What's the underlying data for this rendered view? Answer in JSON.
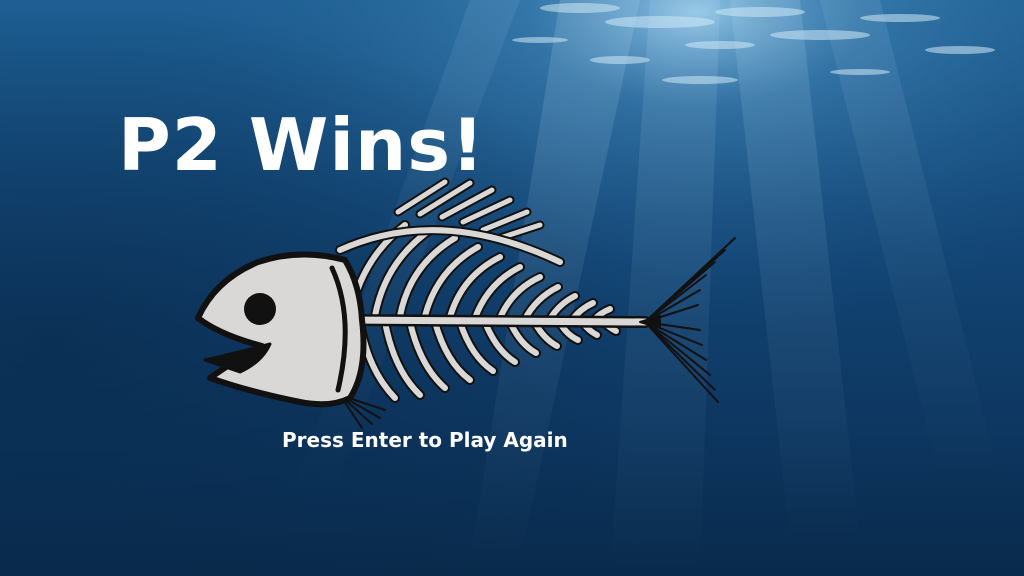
{
  "game": {
    "result_title": "P2 Wins!",
    "prompt": "Press Enter to Play Again"
  },
  "icons": {
    "mascot": "fish-skeleton-icon"
  },
  "colors": {
    "water_deep": "#0a2a4c",
    "water_mid": "#1d5d8e",
    "water_light": "#6fb0d8",
    "bone": "#d9d8d6",
    "outline": "#111111",
    "text": "#ffffff"
  }
}
